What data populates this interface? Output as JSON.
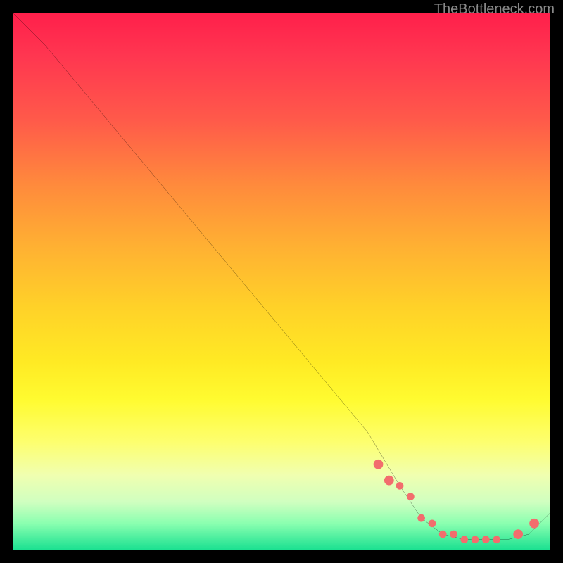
{
  "watermark": "TheBottleneck.com",
  "chart_data": {
    "type": "line",
    "title": "",
    "xlabel": "",
    "ylabel": "",
    "xlim": [
      0,
      100
    ],
    "ylim": [
      0,
      100
    ],
    "series": [
      {
        "name": "curve",
        "x": [
          0,
          6,
          16,
          26,
          36,
          46,
          56,
          66,
          72,
          76,
          80,
          84,
          88,
          92,
          96,
          100
        ],
        "y": [
          100,
          94,
          82,
          70,
          58,
          46,
          34,
          22,
          12,
          6,
          3,
          2,
          2,
          2,
          3,
          7
        ]
      }
    ],
    "markers": {
      "comment": "highlighted points near the valley",
      "x": [
        68,
        70,
        72,
        74,
        76,
        78,
        80,
        82,
        84,
        86,
        88,
        90,
        94,
        97
      ],
      "y": [
        16,
        13,
        12,
        10,
        6,
        5,
        3,
        3,
        2,
        2,
        2,
        2,
        3,
        5
      ],
      "size_small": 3.2,
      "size_big": 4.5
    },
    "colors": {
      "line": "#000000",
      "marker": "#f26d6d",
      "bg_top": "#ff1f4b",
      "bg_bottom": "#18e090"
    }
  }
}
